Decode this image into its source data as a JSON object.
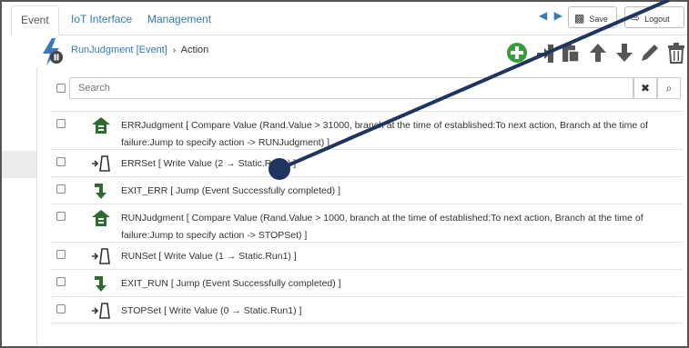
{
  "tabs": [
    {
      "label": "Event",
      "active": true
    },
    {
      "label": "IoT Interface",
      "active": false
    },
    {
      "label": "Management",
      "active": false
    }
  ],
  "header": {
    "nav_arrows": "◀ ▶",
    "save_label": "Save",
    "logout_label": "Logout"
  },
  "breadcrumb": {
    "item": "RunJudgment",
    "type": "[Event]",
    "separator": "›",
    "current": "Action"
  },
  "toolbar": {
    "icons": [
      "add-icon",
      "import-icon",
      "paste-icon",
      "arrow-up-icon",
      "arrow-down-icon",
      "edit-icon",
      "delete-icon"
    ],
    "add_color": "#3a9b3a",
    "icon_color": "#555555"
  },
  "search": {
    "placeholder": "Search",
    "clear_symbol": "✖",
    "search_symbol": "⌕"
  },
  "actions": [
    {
      "icon": "compare-icon",
      "text": "ERRJudgment [ Compare Value (Rand.Value > 31000, branch at the time of established:To next action, Branch at the time of failure:Jump to specify action -> RUNJudgment) ]"
    },
    {
      "icon": "write-icon",
      "text": "ERRSet [ Write Value (2 → Static.Run1) ]"
    },
    {
      "icon": "jump-icon",
      "text": "EXIT_ERR [ Jump (Event Successfully completed) ]"
    },
    {
      "icon": "compare-icon",
      "text": "RUNJudgment [ Compare Value (Rand.Value > 1000, branch at the time of established:To next action, Branch at the time of failure:Jump to specify action -> STOPSet) ]"
    },
    {
      "icon": "write-icon",
      "text": "RUNSet [ Write Value (1 → Static.Run1) ]"
    },
    {
      "icon": "jump-icon",
      "text": "EXIT_RUN [ Jump (Event Successfully completed) ]"
    },
    {
      "icon": "write-icon",
      "text": "STOPSet [ Write Value (0 → Static.Run1) ]"
    }
  ],
  "colors": {
    "link": "#337ab7",
    "compare_icon": "#2e6b2e",
    "jump_icon": "#2e6b2e",
    "annotation_line": "#1f3560"
  }
}
